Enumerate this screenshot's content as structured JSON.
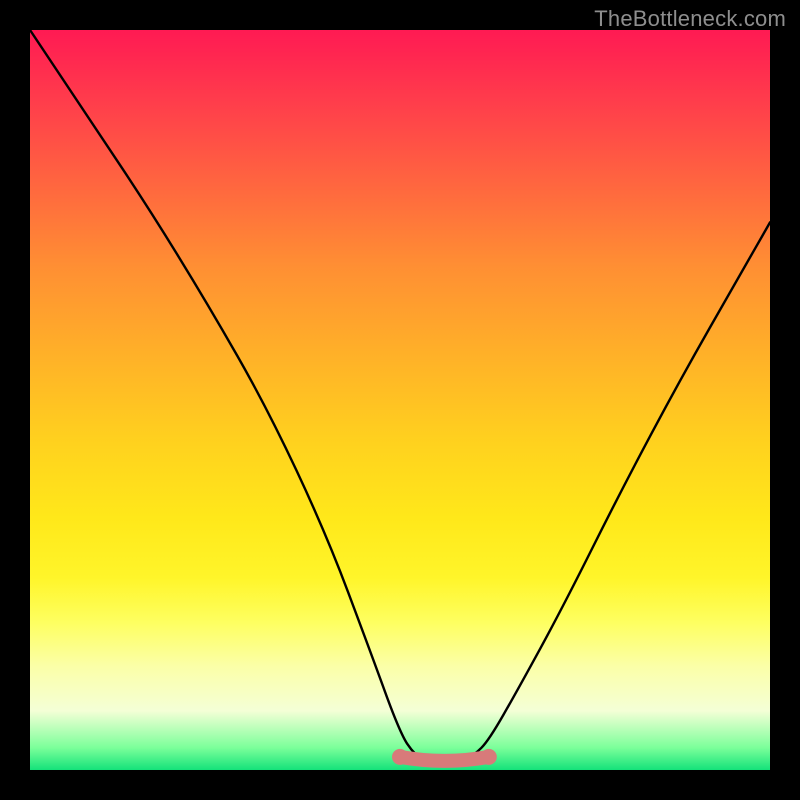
{
  "watermark": "TheBottleneck.com",
  "chart_data": {
    "type": "line",
    "title": "",
    "xlabel": "",
    "ylabel": "",
    "xlim": [
      0,
      100
    ],
    "ylim": [
      0,
      100
    ],
    "series": [
      {
        "name": "bottleneck-curve",
        "x": [
          0,
          8,
          16,
          24,
          32,
          40,
          46,
          50,
          52,
          54,
          56,
          58,
          60,
          62,
          66,
          72,
          80,
          88,
          96,
          100
        ],
        "values": [
          100,
          88,
          76,
          63,
          49,
          32,
          16,
          5,
          2,
          1,
          1,
          1,
          2,
          4,
          11,
          22,
          38,
          53,
          67,
          74
        ]
      }
    ],
    "gradient_stops": [
      {
        "pct": 0,
        "color": "#ff1a53"
      },
      {
        "pct": 10,
        "color": "#ff3e4b"
      },
      {
        "pct": 22,
        "color": "#ff6a3e"
      },
      {
        "pct": 32,
        "color": "#ff8f33"
      },
      {
        "pct": 44,
        "color": "#ffb128"
      },
      {
        "pct": 56,
        "color": "#ffd21e"
      },
      {
        "pct": 66,
        "color": "#ffe81a"
      },
      {
        "pct": 74,
        "color": "#fff52a"
      },
      {
        "pct": 80,
        "color": "#feff60"
      },
      {
        "pct": 86,
        "color": "#fbffa8"
      },
      {
        "pct": 92,
        "color": "#f4ffd6"
      },
      {
        "pct": 97,
        "color": "#7bff9a"
      },
      {
        "pct": 100,
        "color": "#14e27a"
      }
    ],
    "flat_bottom": {
      "x_start": 50,
      "x_end": 62,
      "y": 1.5,
      "color": "#d87a7a"
    }
  }
}
